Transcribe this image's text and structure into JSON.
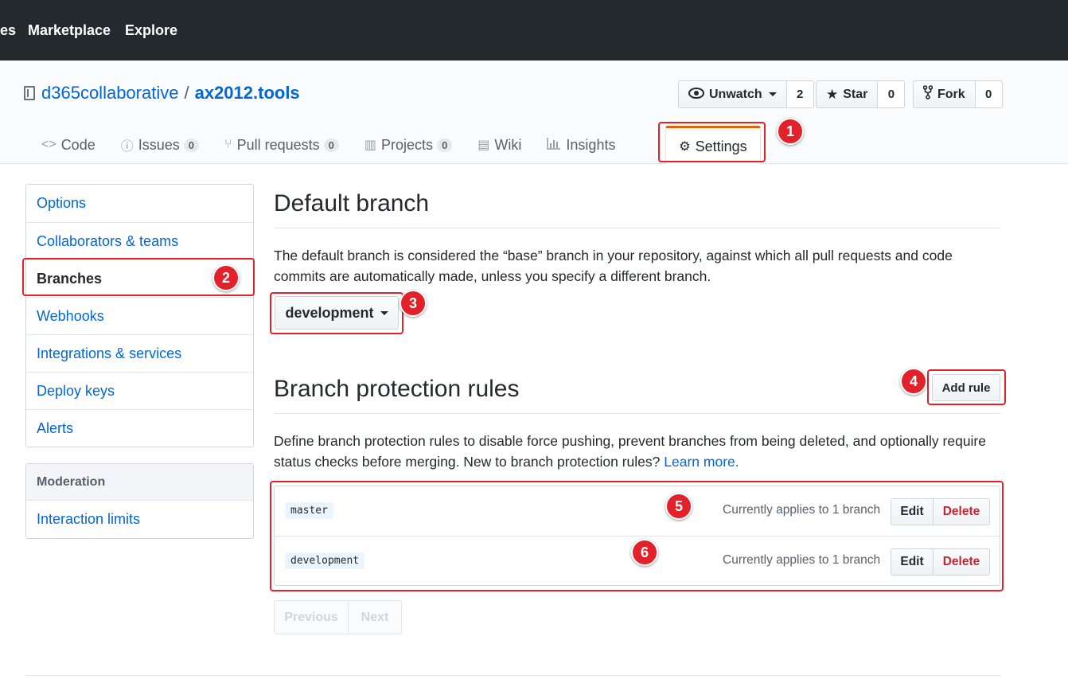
{
  "topnav": {
    "item_partial": "es",
    "marketplace": "Marketplace",
    "explore": "Explore"
  },
  "repo": {
    "owner": "d365collaborative",
    "separator": "/",
    "name": "ax2012.tools"
  },
  "actions": {
    "watch": {
      "label": "Unwatch",
      "count": "2",
      "icon": "eye-icon"
    },
    "star": {
      "label": "Star",
      "count": "0",
      "icon": "star-icon"
    },
    "fork": {
      "label": "Fork",
      "count": "0",
      "icon": "fork-icon"
    }
  },
  "tabs": [
    {
      "label": "Code",
      "icon": "code-icon"
    },
    {
      "label": "Issues",
      "count": "0",
      "icon": "issue-icon"
    },
    {
      "label": "Pull requests",
      "count": "0",
      "icon": "pull-request-icon"
    },
    {
      "label": "Projects",
      "count": "0",
      "icon": "project-icon"
    },
    {
      "label": "Wiki",
      "icon": "book-icon"
    },
    {
      "label": "Insights",
      "icon": "graph-icon"
    },
    {
      "label": "Settings",
      "icon": "gear-icon",
      "selected": true
    }
  ],
  "sidebar": {
    "items": [
      "Options",
      "Collaborators & teams",
      "Branches",
      "Webhooks",
      "Integrations & services",
      "Deploy keys",
      "Alerts"
    ],
    "selected": "Branches",
    "moderation_heading": "Moderation",
    "moderation_items": [
      "Interaction limits"
    ]
  },
  "default_branch": {
    "heading": "Default branch",
    "description": "The default branch is considered the “base” branch in your repository, against which all pull requests and code commits are automatically made, unless you specify a different branch.",
    "selected_branch": "development"
  },
  "protection": {
    "heading": "Branch protection rules",
    "add_rule_label": "Add rule",
    "description": "Define branch protection rules to disable force pushing, prevent branches from being deleted, and optionally require status checks before merging. New to branch protection rules?",
    "learn_more": "Learn more.",
    "rules": [
      {
        "pattern": "master",
        "applies": "Currently applies to 1 branch",
        "edit": "Edit",
        "delete": "Delete"
      },
      {
        "pattern": "development",
        "applies": "Currently applies to 1 branch",
        "edit": "Edit",
        "delete": "Delete"
      }
    ],
    "pagination": {
      "previous": "Previous",
      "next": "Next"
    }
  },
  "annotations": [
    "1",
    "2",
    "3",
    "4",
    "5",
    "6"
  ],
  "colors": {
    "accent": "#0366d6",
    "annotation": "#e3212b",
    "danger": "#cb2431",
    "header": "#24292e",
    "tab_top": "#e36209"
  }
}
